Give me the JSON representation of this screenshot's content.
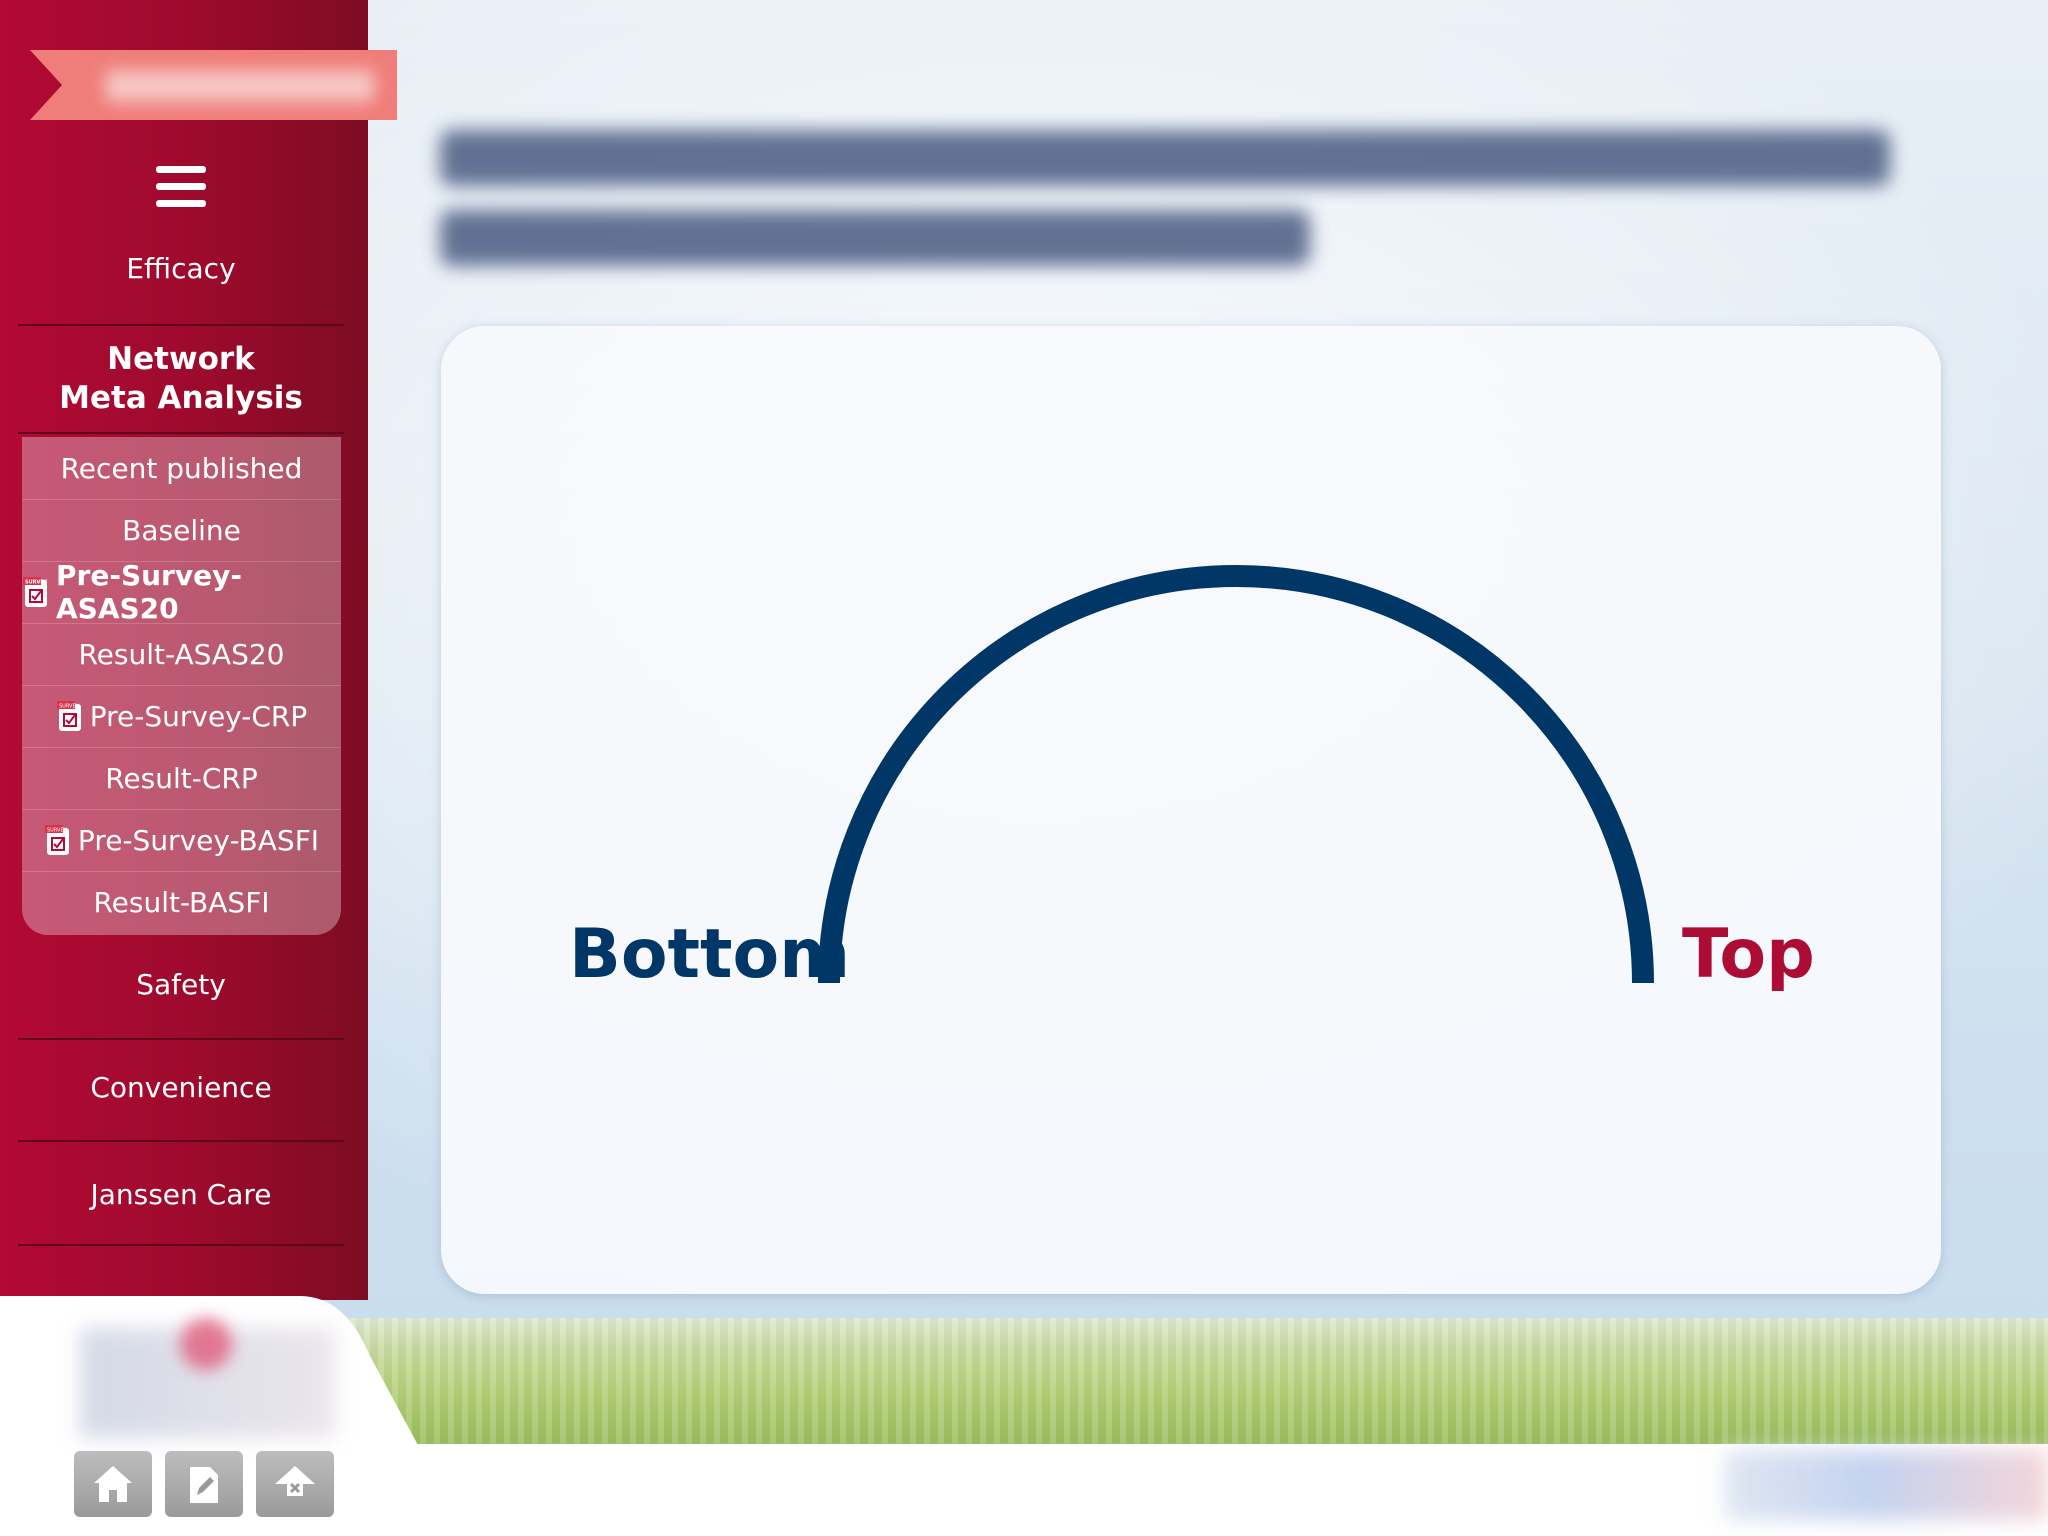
{
  "sidebar": {
    "items": {
      "efficacy": "Efficacy",
      "network_meta": [
        "Network",
        "Meta Analysis"
      ],
      "safety": "Safety",
      "convenience": "Convenience",
      "janssen_care": "Janssen Care"
    },
    "sub_items": [
      {
        "label": "Recent published",
        "icon": null,
        "active": false
      },
      {
        "label": "Baseline",
        "icon": null,
        "active": false
      },
      {
        "label": "Pre-Survey-ASAS20",
        "icon": "survey-icon",
        "active": true
      },
      {
        "label": "Result-ASAS20",
        "icon": null,
        "active": false
      },
      {
        "label": "Pre-Survey-CRP",
        "icon": "survey-icon",
        "active": false
      },
      {
        "label": "Result-CRP",
        "icon": null,
        "active": false
      },
      {
        "label": "Pre-Survey-BASFI",
        "icon": "survey-icon",
        "active": false
      },
      {
        "label": "Result-BASFI",
        "icon": null,
        "active": false
      }
    ],
    "survey_icon_text": "SURVEY"
  },
  "toolbar": {
    "buttons": [
      "home-icon",
      "edit-icon",
      "share-icon"
    ]
  },
  "gauge": {
    "left_label": "Bottom",
    "right_label": "Top",
    "arc_color": "#013767",
    "left_label_color": "#013767",
    "right_label_color": "#ad0c34"
  },
  "colors": {
    "sidebar": "#a3092f",
    "ribbon": "#ef7e7a",
    "active_subitem": "#ffffff"
  }
}
